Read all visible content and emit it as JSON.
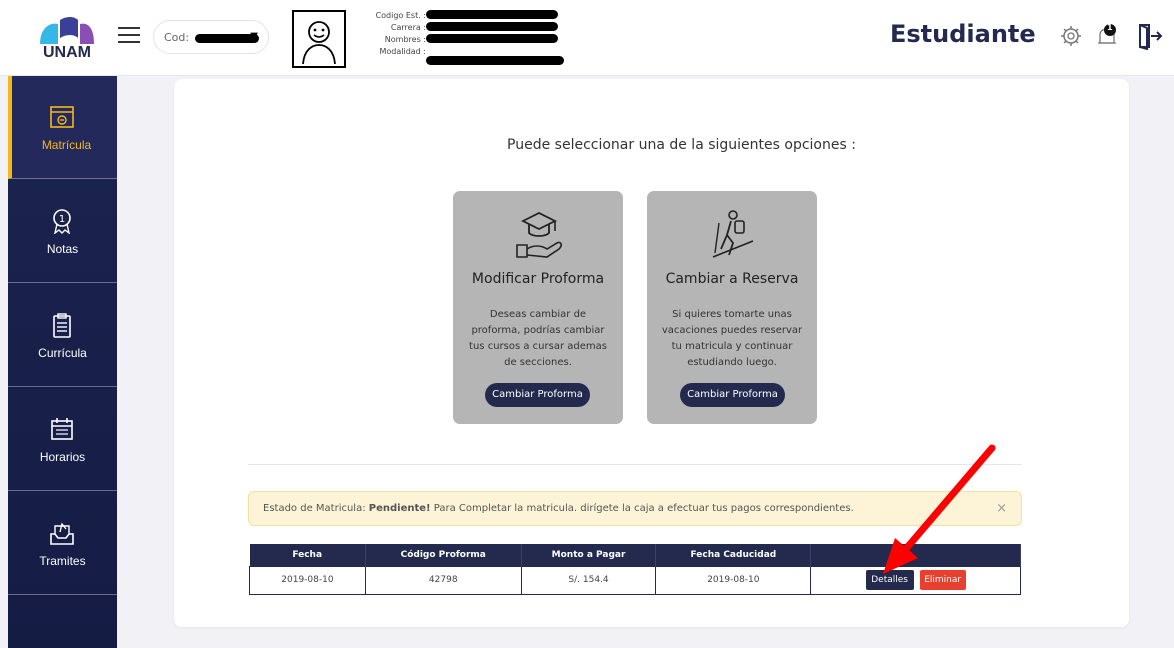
{
  "header": {
    "logo_text": "UNAM",
    "cod_label": "Cod:",
    "info_labels": [
      "Codigo Est. :",
      "Carrera :",
      "Nombres :",
      "Modalidad :"
    ],
    "role_title": "Estudiante",
    "notification_count": "1"
  },
  "sidebar": {
    "items": [
      {
        "label": "Matrícula"
      },
      {
        "label": "Notas"
      },
      {
        "label": "Currícula"
      },
      {
        "label": "Horarios"
      },
      {
        "label": "Tramites"
      }
    ]
  },
  "main": {
    "lead": "Puede seleccionar una de la siguientes opciones :",
    "options": [
      {
        "title": "Modificar Proforma",
        "desc": "Deseas cambiar de proforma, podrías cambiar tus cursos a cursar ademas de secciones.",
        "button": "Cambiar Proforma"
      },
      {
        "title": "Cambiar a Reserva",
        "desc": "Si quieres tomarte unas vacaciones puedes reservar tu matricula y continuar estudiando luego.",
        "button": "Cambiar Proforma"
      }
    ],
    "alert": {
      "prefix": "Estado de Matricula: ",
      "status": "Pendiente!",
      "suffix": " Para Completar la matricula. dirígete la caja a efectuar tus pagos correspondientes.",
      "close": "×"
    },
    "table": {
      "headers": [
        "Fecha",
        "Código Proforma",
        "Monto a Pagar",
        "Fecha Caducidad",
        ""
      ],
      "row": {
        "fecha": "2019-08-10",
        "codigo": "42798",
        "monto": "S/. 154.4",
        "caducidad": "2019-08-10"
      },
      "details_button": "Detalles",
      "delete_button": "Eliminar"
    }
  },
  "colors": {
    "brand_navy": "#232a4e",
    "accent_yellow": "#f3b81a",
    "danger": "#e8402f",
    "annotation_red": "#ff0000"
  }
}
